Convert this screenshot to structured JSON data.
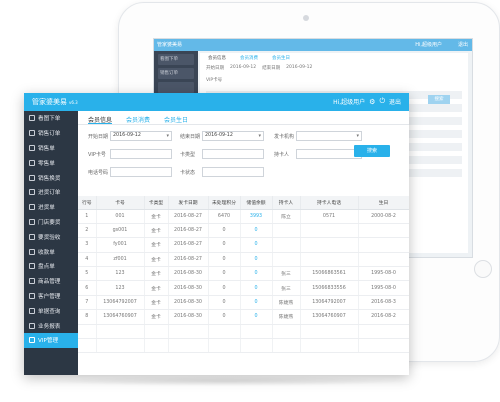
{
  "app": {
    "brand": "管家婆美易",
    "version": "v6.3",
    "user": "Hi,超级用户",
    "logout": "退出"
  },
  "back_screen": {
    "brand": "管家婆美易",
    "user": "Hi,超级用户",
    "logout": "退出",
    "sidebar": [
      "看图下单",
      "销售订单"
    ],
    "tabs": [
      "会员信息",
      "会员消费",
      "会员生日"
    ],
    "start_label": "开始日期",
    "start_value": "2016-09-12",
    "end_label": "结束日期",
    "end_value": "2016-09-12",
    "vip_label": "VIP卡号",
    "search": "搜索"
  },
  "sidebar": {
    "items": [
      {
        "label": "看图下单"
      },
      {
        "label": "销售订单"
      },
      {
        "label": "销售单"
      },
      {
        "label": "零售单"
      },
      {
        "label": "销售换货"
      },
      {
        "label": "进货订单"
      },
      {
        "label": "进货单"
      },
      {
        "label": "门店要货"
      },
      {
        "label": "要货验收"
      },
      {
        "label": "收款单"
      },
      {
        "label": "盘点单"
      },
      {
        "label": "商品管理"
      },
      {
        "label": "客户管理"
      },
      {
        "label": "单据查询"
      },
      {
        "label": "业务报表"
      },
      {
        "label": "VIP管理"
      }
    ]
  },
  "tabs": [
    {
      "label": "会员信息"
    },
    {
      "label": "会员消费"
    },
    {
      "label": "会员生日"
    }
  ],
  "form": {
    "start_label": "开始日期",
    "start_value": "2016-09-12",
    "end_label": "结束日期",
    "end_value": "2016-09-12",
    "shop_label": "发卡机构",
    "vip_label": "VIP卡号",
    "card_type_label": "卡类型",
    "holder_label": "持卡人",
    "phone_label": "电话号码",
    "status_label": "卡状态",
    "search_button": "搜索"
  },
  "table": {
    "headers": [
      "行号",
      "卡号",
      "卡类型",
      "发卡日期",
      "未处理积分",
      "储值余额",
      "持卡人",
      "持卡人电话",
      "生日"
    ],
    "rows": [
      [
        "1",
        "001",
        "金卡",
        "2016-08-27",
        "6470",
        "3993",
        "陈立",
        "0571",
        "2000-08-2"
      ],
      [
        "2",
        "gs001",
        "金卡",
        "2016-08-27",
        "0",
        "0",
        "",
        "",
        ""
      ],
      [
        "3",
        "fy001",
        "金卡",
        "2016-08-27",
        "0",
        "0",
        "",
        "",
        ""
      ],
      [
        "4",
        "zf001",
        "金卡",
        "2016-08-27",
        "0",
        "0",
        "",
        "",
        ""
      ],
      [
        "5",
        "123",
        "金卡",
        "2016-08-30",
        "0",
        "0",
        "张三",
        "15066863561",
        "1995-08-0"
      ],
      [
        "6",
        "123",
        "金卡",
        "2016-08-30",
        "0",
        "0",
        "张三",
        "15066833556",
        "1995-08-0"
      ],
      [
        "7",
        "13064792007",
        "金卡",
        "2016-08-30",
        "0",
        "0",
        "陈婕燕",
        "13064792007",
        "2016-08-3"
      ],
      [
        "8",
        "13064760907",
        "金卡",
        "2016-08-30",
        "0",
        "0",
        "陈婕燕",
        "13064760907",
        "2016-08-2"
      ]
    ]
  },
  "colors": {
    "accent": "#29b1ea",
    "sidebar": "#2c3744",
    "highlight_value": "#29b1ea"
  }
}
